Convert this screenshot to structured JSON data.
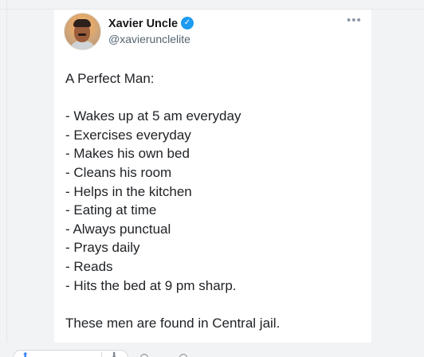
{
  "tweet": {
    "author": {
      "name": "Xavier Uncle",
      "handle": "@xavierunclelite"
    },
    "lines": [
      "A Perfect Man:",
      "",
      "- Wakes up at 5 am everyday",
      "- Exercises everyday",
      "- Makes his own bed",
      "- Cleans his room",
      "- Helps in the kitchen",
      "- Eating at time",
      "- Always punctual",
      "- Prays daily",
      "- Reads",
      "- Hits the bed at 9 pm sharp.",
      "",
      "These men are found in Central jail."
    ]
  },
  "icons": {
    "verified": "verified-badge-icon",
    "more": "more-horizontal-icon",
    "upvote": "upvote-icon",
    "downvote": "downvote-icon",
    "comments": "comment-icon",
    "share": "share-icon"
  },
  "colors": {
    "accent": "#1d9bf0",
    "text": "#202327",
    "secondary": "#536471",
    "background": "#f2f3f5"
  }
}
